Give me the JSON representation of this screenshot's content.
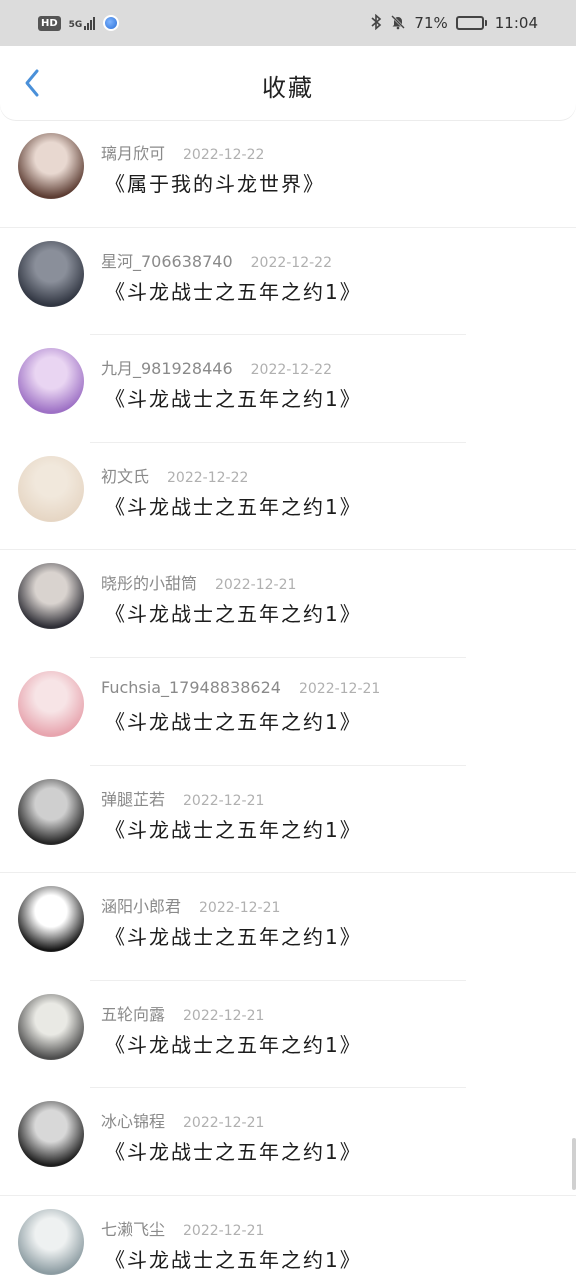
{
  "status_bar": {
    "hd": "HD",
    "network": "5G",
    "battery_percent": "71%",
    "battery_level": 0.71,
    "time": "11:04",
    "icons": [
      "bluetooth-icon",
      "mute-bell-icon",
      "battery-icon",
      "signal-icon"
    ]
  },
  "header": {
    "title": "收藏",
    "back_icon": "chevron-left-icon",
    "accent": "#4a90d9"
  },
  "favorites": [
    {
      "user": "璃月欣可",
      "date": "2022-12-22",
      "book": "《属于我的斗龙世界》",
      "avatar_colors": [
        "#e8d8d0",
        "#5a3a30"
      ]
    },
    {
      "user": "星河_706638740",
      "date": "2022-12-22",
      "book": "《斗龙战士之五年之约1》",
      "avatar_colors": [
        "#8a8f9a",
        "#2f3440"
      ]
    },
    {
      "user": "九月_981928446",
      "date": "2022-12-22",
      "book": "《斗龙战士之五年之约1》",
      "avatar_colors": [
        "#e9d5f2",
        "#9c6fc4"
      ]
    },
    {
      "user": "初文氏",
      "date": "2022-12-22",
      "book": "《斗龙战士之五年之约1》",
      "avatar_colors": [
        "#f1e8dc",
        "#e6d6c4"
      ]
    },
    {
      "user": "晓彤的小甜筒",
      "date": "2022-12-21",
      "book": "《斗龙战士之五年之约1》",
      "avatar_colors": [
        "#d9d3cf",
        "#2b2b33"
      ]
    },
    {
      "user": "Fuchsia_17948838624",
      "date": "2022-12-21",
      "book": "《斗龙战士之五年之约1》",
      "avatar_colors": [
        "#f7e4e6",
        "#e7a3ad"
      ]
    },
    {
      "user": "弹腿芷若",
      "date": "2022-12-21",
      "book": "《斗龙战士之五年之约1》",
      "avatar_colors": [
        "#cfcfcf",
        "#222222"
      ]
    },
    {
      "user": "涵阳小郎君",
      "date": "2022-12-21",
      "book": "《斗龙战士之五年之约1》",
      "avatar_colors": [
        "#ffffff",
        "#111111"
      ]
    },
    {
      "user": "五轮向露",
      "date": "2022-12-21",
      "book": "《斗龙战士之五年之约1》",
      "avatar_colors": [
        "#e9e9e4",
        "#4a4a4a"
      ]
    },
    {
      "user": "冰心锦程",
      "date": "2022-12-21",
      "book": "《斗龙战士之五年之约1》",
      "avatar_colors": [
        "#d8d8d8",
        "#1a1a1a"
      ]
    },
    {
      "user": "七濑飞尘",
      "date": "2022-12-21",
      "book": "《斗龙战士之五年之约1》",
      "avatar_colors": [
        "#eef1f1",
        "#8a9aa0"
      ]
    }
  ]
}
